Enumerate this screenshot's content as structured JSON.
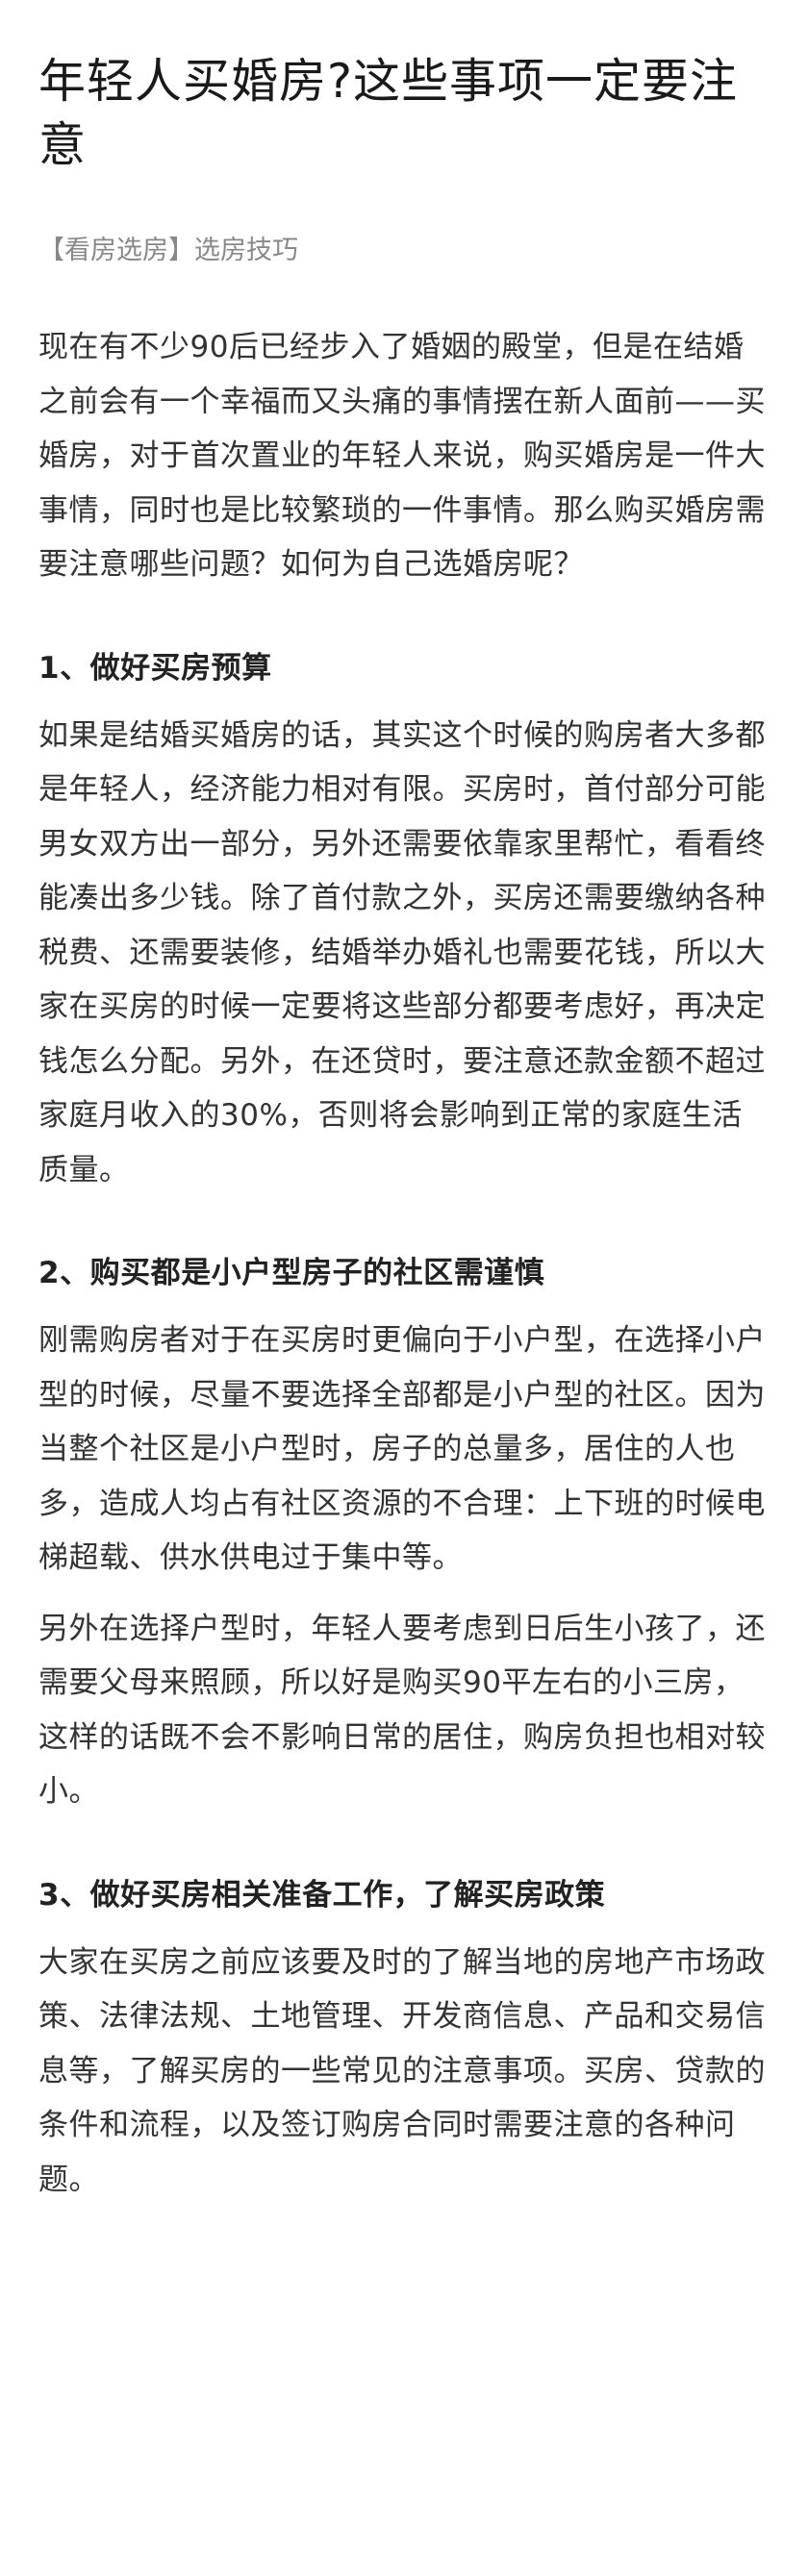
{
  "article": {
    "title": "年轻人买婚房?这些事项一定要注意",
    "source": "【看房选房】选房技巧",
    "intro": "现在有不少90后已经步入了婚姻的殿堂，但是在结婚之前会有一个幸福而又头痛的事情摆在新人面前——买婚房，对于首次置业的年轻人来说，购买婚房是一件大事情，同时也是比较繁琐的一件事情。那么购买婚房需要注意哪些问题？如何为自己选婚房呢？",
    "sections": [
      {
        "heading": "1、做好买房预算",
        "paragraphs": [
          "如果是结婚买婚房的话，其实这个时候的购房者大多都是年轻人，经济能力相对有限。买房时，首付部分可能男女双方出一部分，另外还需要依靠家里帮忙，看看终能凑出多少钱。除了首付款之外，买房还需要缴纳各种税费、还需要装修，结婚举办婚礼也需要花钱，所以大家在买房的时候一定要将这些部分都要考虑好，再决定钱怎么分配。另外，在还贷时，要注意还款金额不超过家庭月收入的30%，否则将会影响到正常的家庭生活质量。"
        ]
      },
      {
        "heading": "2、购买都是小户型房子的社区需谨慎",
        "paragraphs": [
          "刚需购房者对于在买房时更偏向于小户型，在选择小户型的时候，尽量不要选择全部都是小户型的社区。因为当整个社区是小户型时，房子的总量多，居住的人也多，造成人均占有社区资源的不合理：上下班的时候电梯超载、供水供电过于集中等。",
          "另外在选择户型时，年轻人要考虑到日后生小孩了，还需要父母来照顾，所以好是购买90平左右的小三房，这样的话既不会不影响日常的居住，购房负担也相对较小。"
        ]
      },
      {
        "heading": "3、做好买房相关准备工作，了解买房政策",
        "paragraphs": [
          "大家在买房之前应该要及时的了解当地的房地产市场政策、法律法规、土地管理、开发商信息、产品和交易信息等，了解买房的一些常见的注意事项。买房、贷款的条件和流程，以及签订购房合同时需要注意的各种问题。"
        ]
      }
    ]
  }
}
